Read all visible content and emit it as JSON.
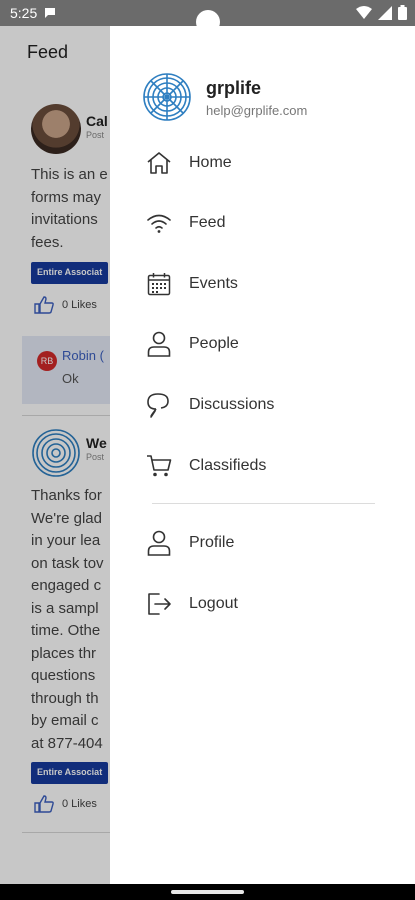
{
  "status_bar": {
    "time": "5:25"
  },
  "feed": {
    "title": "Feed",
    "posts": [
      {
        "author": "Cal",
        "posted": "Post",
        "body_lines": [
          "This is an e",
          "forms may",
          "invitations",
          "fees."
        ],
        "badge": "Entire Associat",
        "likes": "0 Likes",
        "comment": {
          "initials": "RB",
          "name": "Robin (",
          "text": "Ok"
        }
      },
      {
        "author": "We",
        "posted": "Post",
        "body_lines": [
          "Thanks for",
          "We're glad",
          "in your lea",
          "on task tov",
          "engaged c",
          "is a sampl",
          "time. Othe",
          "places thr",
          "questions",
          "through th",
          "by email c",
          "at 877-404"
        ],
        "badge": "Entire Associat",
        "likes": "0 Likes"
      }
    ]
  },
  "drawer": {
    "app_name": "grplife",
    "email": "help@grplife.com",
    "items": [
      {
        "label": "Home",
        "icon": "home-icon"
      },
      {
        "label": "Feed",
        "icon": "wifi-icon"
      },
      {
        "label": "Events",
        "icon": "calendar-icon"
      },
      {
        "label": "People",
        "icon": "person-icon"
      },
      {
        "label": "Discussions",
        "icon": "chat-icon"
      },
      {
        "label": "Classifieds",
        "icon": "cart-icon"
      }
    ],
    "secondary_items": [
      {
        "label": "Profile",
        "icon": "person-icon"
      },
      {
        "label": "Logout",
        "icon": "logout-icon"
      }
    ]
  },
  "colors": {
    "accent": "#163a9e",
    "logo": "#2f7fc1",
    "scrim": "#000000",
    "badge_red": "#d12a2a"
  }
}
